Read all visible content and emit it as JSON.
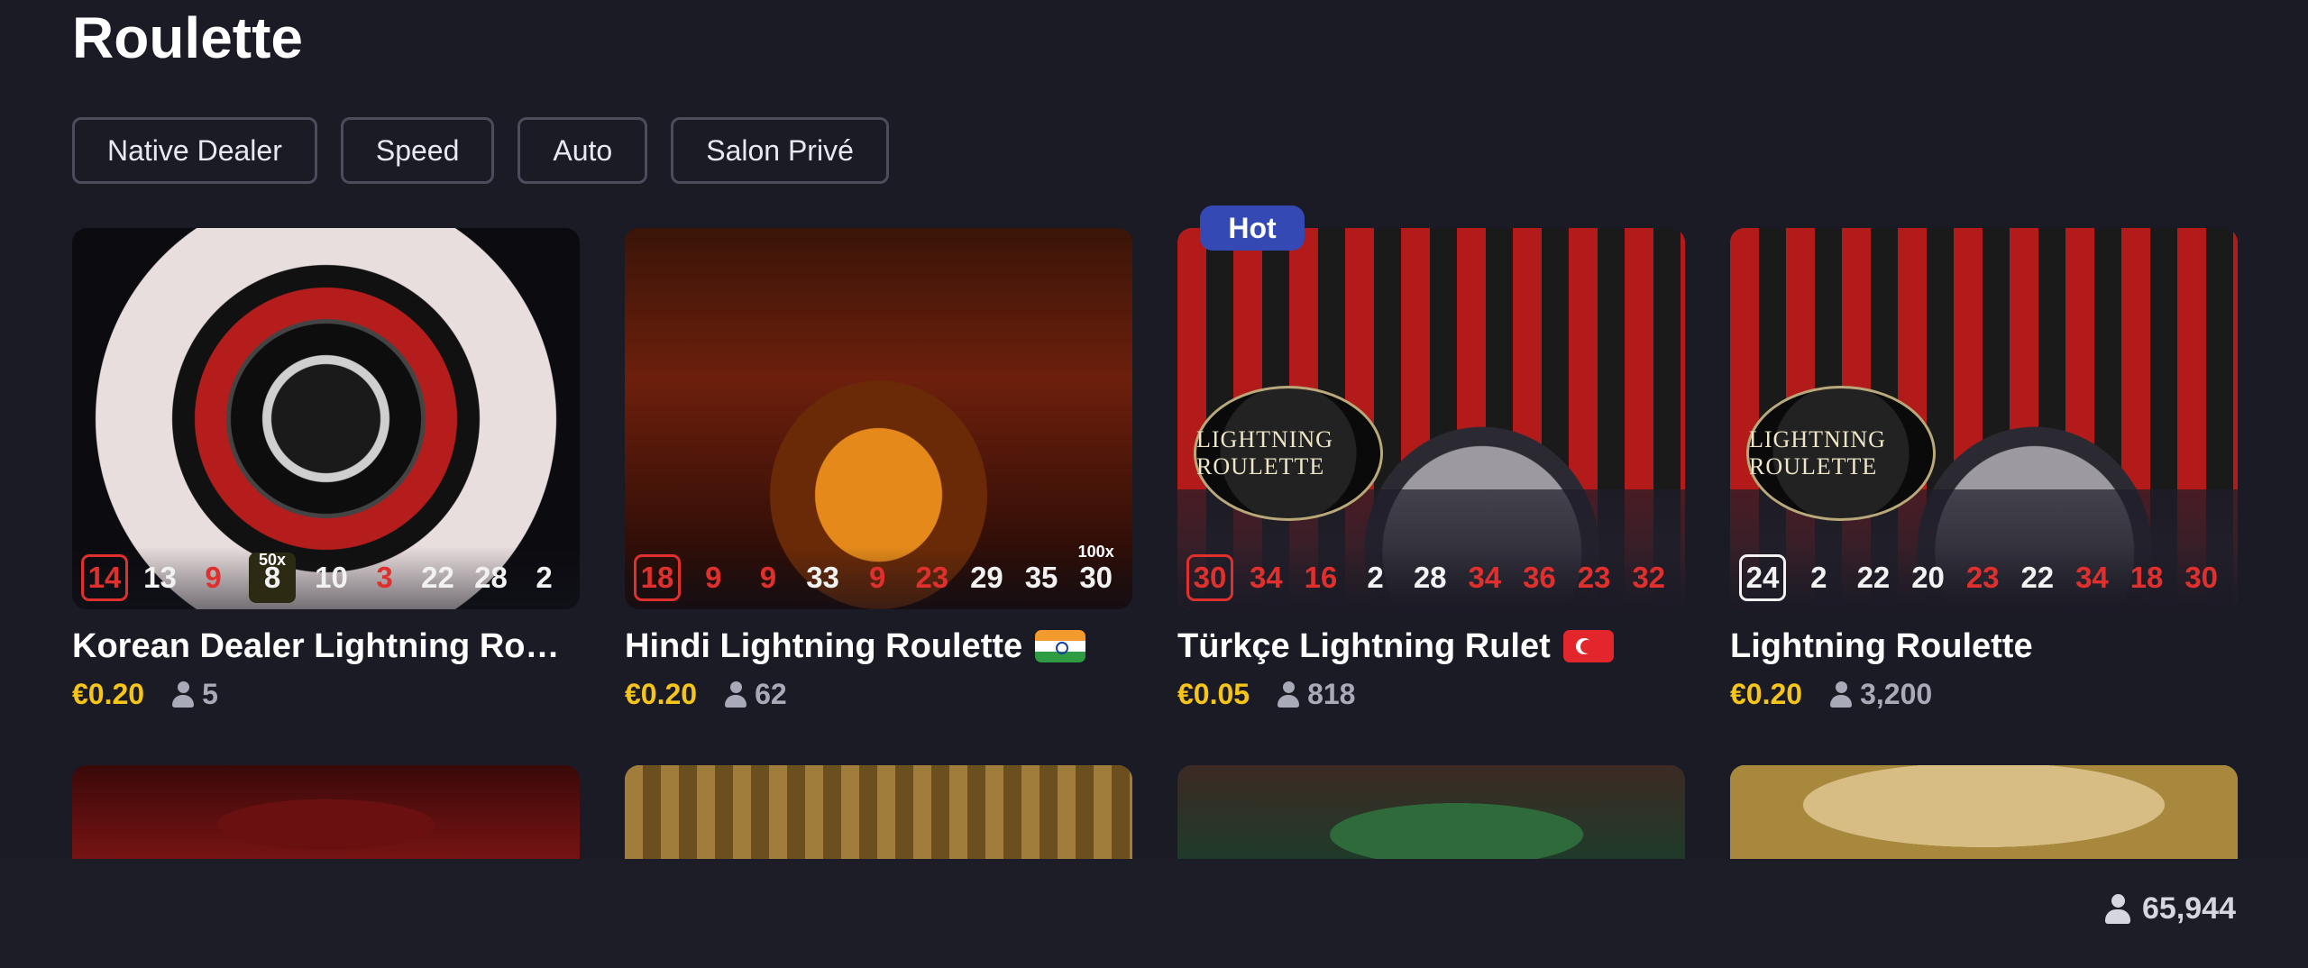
{
  "page": {
    "title": "Roulette"
  },
  "filters": [
    "Native Dealer",
    "Speed",
    "Auto",
    "Salon Privé"
  ],
  "badges": {
    "hot": "Hot"
  },
  "games": [
    {
      "title": "Korean Dealer Lightning Roul...",
      "price": "€0.20",
      "players": "5",
      "numbers": [
        {
          "n": "14",
          "color": "red"
        },
        {
          "n": "13",
          "color": "white"
        },
        {
          "n": "9",
          "color": "red"
        },
        {
          "n": "8",
          "color": "white",
          "mult": "50x",
          "boxed": true
        },
        {
          "n": "10",
          "color": "white"
        },
        {
          "n": "3",
          "color": "red"
        },
        {
          "n": "22",
          "color": "white"
        },
        {
          "n": "28",
          "color": "white"
        },
        {
          "n": "2",
          "color": "white"
        }
      ]
    },
    {
      "title": "Hindi Lightning Roulette",
      "price": "€0.20",
      "players": "62",
      "flag": "india",
      "numbers": [
        {
          "n": "18",
          "color": "red"
        },
        {
          "n": "9",
          "color": "red"
        },
        {
          "n": "9",
          "color": "red"
        },
        {
          "n": "33",
          "color": "white"
        },
        {
          "n": "9",
          "color": "red"
        },
        {
          "n": "23",
          "color": "red"
        },
        {
          "n": "29",
          "color": "white"
        },
        {
          "n": "35",
          "color": "white"
        },
        {
          "n": "30",
          "color": "white",
          "mult": "100x"
        }
      ]
    },
    {
      "title": "Türkçe Lightning Rulet",
      "price": "€0.05",
      "players": "818",
      "flag": "turkey",
      "hot": true,
      "logo": "LIGHTNING ROULETTE",
      "numbers": [
        {
          "n": "30",
          "color": "red"
        },
        {
          "n": "34",
          "color": "red"
        },
        {
          "n": "16",
          "color": "red"
        },
        {
          "n": "2",
          "color": "white"
        },
        {
          "n": "28",
          "color": "white"
        },
        {
          "n": "34",
          "color": "red"
        },
        {
          "n": "36",
          "color": "red"
        },
        {
          "n": "23",
          "color": "red"
        },
        {
          "n": "32",
          "color": "red"
        }
      ]
    },
    {
      "title": "Lightning Roulette",
      "price": "€0.20",
      "players": "3,200",
      "logo": "LIGHTNING ROULETTE",
      "numbers": [
        {
          "n": "24",
          "color": "white"
        },
        {
          "n": "2",
          "color": "white"
        },
        {
          "n": "22",
          "color": "white"
        },
        {
          "n": "20",
          "color": "white"
        },
        {
          "n": "23",
          "color": "red"
        },
        {
          "n": "22",
          "color": "white"
        },
        {
          "n": "34",
          "color": "red"
        },
        {
          "n": "18",
          "color": "red"
        },
        {
          "n": "30",
          "color": "red"
        }
      ]
    }
  ],
  "total_online": "65,944",
  "colors": {
    "background": "#1b1b26",
    "price": "#f5c518",
    "red_number": "#e0302e",
    "hot_badge": "#3449b3"
  },
  "icons": {
    "players": "person-icon"
  }
}
